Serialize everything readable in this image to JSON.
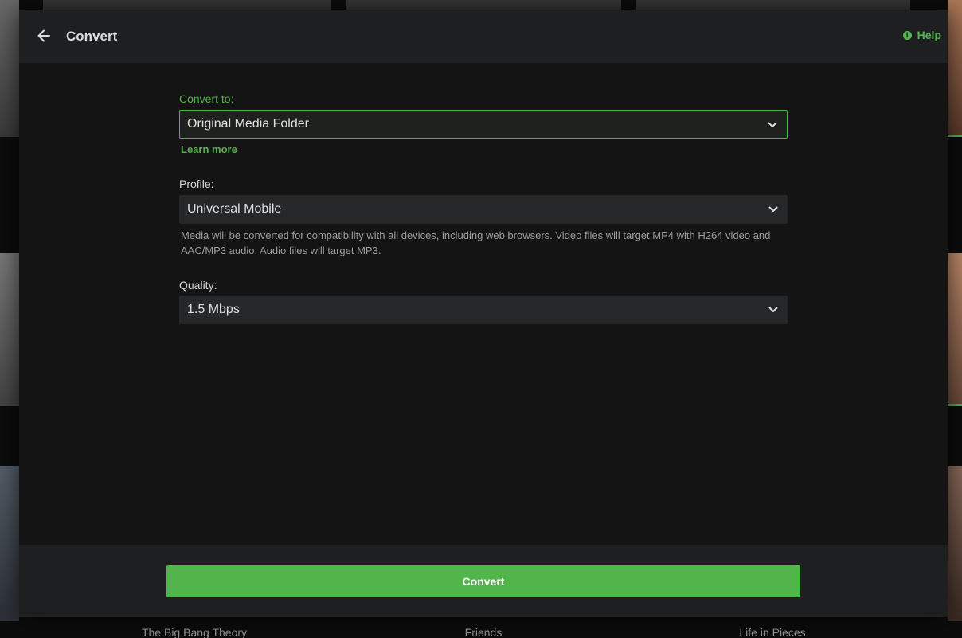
{
  "header": {
    "title": "Convert",
    "help_label": "Help"
  },
  "form": {
    "convert_to": {
      "label": "Convert to:",
      "value": "Original Media Folder",
      "learn_more": "Learn more"
    },
    "profile": {
      "label": "Profile:",
      "value": "Universal Mobile",
      "description": "Media will be converted for compatibility with all devices, including web browsers. Video files will target MP4 with H264 video and AAC/MP3 audio. Audio files will target MP3."
    },
    "quality": {
      "label": "Quality:",
      "value": "1.5 Mbps"
    }
  },
  "footer": {
    "convert_label": "Convert"
  },
  "background": {
    "captions": [
      "The Big Bang Theory",
      "Friends",
      "Life in Pieces"
    ]
  },
  "colors": {
    "accent": "#52b54b",
    "modal_bg": "#141414",
    "header_bg": "#1e1f21"
  },
  "icons": {
    "back": "arrow-left-icon",
    "help": "info-icon",
    "dropdown": "chevron-down-icon"
  }
}
